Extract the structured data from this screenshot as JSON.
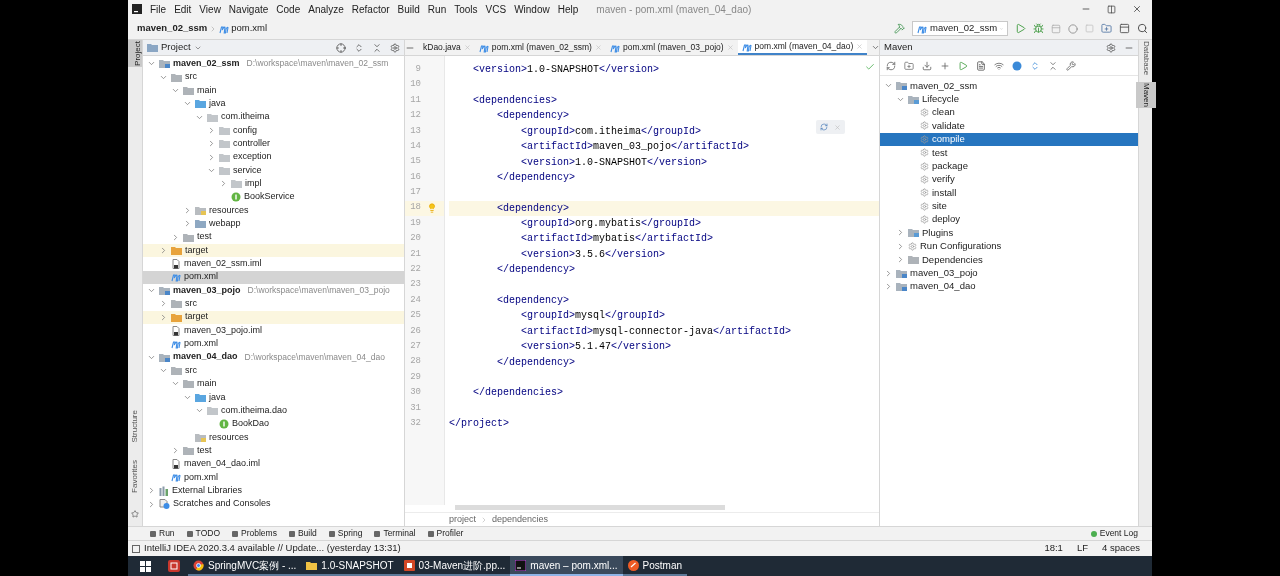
{
  "window": {
    "title": "maven - pom.xml (maven_04_dao)",
    "menu": [
      "File",
      "Edit",
      "View",
      "Navigate",
      "Code",
      "Analyze",
      "Refactor",
      "Build",
      "Run",
      "Tools",
      "VCS",
      "Window",
      "Help"
    ]
  },
  "navbar": {
    "breadcrumb": [
      "maven_02_ssm",
      "pom.xml"
    ],
    "run_config": "maven_02_ssm"
  },
  "left_strip": [
    {
      "label": "Project",
      "selected": true
    },
    {
      "label": "Structure",
      "selected": false
    },
    {
      "label": "Favorites",
      "selected": false
    }
  ],
  "project": {
    "title": "Project",
    "tree": [
      {
        "label": "maven_02_ssm",
        "kind": "module",
        "path": "D:\\workspace\\maven\\maven_02_ssm",
        "expanded": true,
        "selected": false,
        "children": [
          {
            "label": "src",
            "kind": "folder",
            "expanded": true,
            "selected": false,
            "children": [
              {
                "label": "main",
                "kind": "folder",
                "expanded": true,
                "selected": false,
                "children": [
                  {
                    "label": "java",
                    "kind": "source",
                    "expanded": true,
                    "selected": false,
                    "children": [
                      {
                        "label": "com.itheima",
                        "kind": "package",
                        "expanded": true,
                        "selected": false,
                        "children": [
                          {
                            "label": "config",
                            "kind": "package",
                            "expanded": false,
                            "selected": false
                          },
                          {
                            "label": "controller",
                            "kind": "package",
                            "expanded": false,
                            "selected": false
                          },
                          {
                            "label": "exception",
                            "kind": "package",
                            "expanded": false,
                            "selected": false
                          },
                          {
                            "label": "service",
                            "kind": "package",
                            "expanded": true,
                            "selected": false,
                            "children": [
                              {
                                "label": "impl",
                                "kind": "package",
                                "expanded": false,
                                "selected": false
                              },
                              {
                                "label": "BookService",
                                "kind": "interface",
                                "selected": false
                              }
                            ]
                          }
                        ]
                      }
                    ]
                  },
                  {
                    "label": "resources",
                    "kind": "resources",
                    "expanded": false,
                    "selected": false
                  },
                  {
                    "label": "webapp",
                    "kind": "web",
                    "expanded": false,
                    "selected": false
                  }
                ]
              },
              {
                "label": "test",
                "kind": "folder",
                "expanded": false,
                "selected": false
              }
            ]
          },
          {
            "label": "target",
            "kind": "target",
            "expanded": false,
            "selected": false
          },
          {
            "label": "maven_02_ssm.iml",
            "kind": "iml",
            "selected": false
          },
          {
            "label": "pom.xml",
            "kind": "pom",
            "selected": true
          }
        ]
      },
      {
        "label": "maven_03_pojo",
        "kind": "module",
        "path": "D:\\workspace\\maven\\maven_03_pojo",
        "expanded": true,
        "selected": false,
        "children": [
          {
            "label": "src",
            "kind": "folder",
            "expanded": false,
            "selected": false
          },
          {
            "label": "target",
            "kind": "target",
            "expanded": false,
            "selected": false
          },
          {
            "label": "maven_03_pojo.iml",
            "kind": "iml",
            "selected": false
          },
          {
            "label": "pom.xml",
            "kind": "pom",
            "selected": false
          }
        ]
      },
      {
        "label": "maven_04_dao",
        "kind": "module",
        "path": "D:\\workspace\\maven\\maven_04_dao",
        "expanded": true,
        "selected": false,
        "children": [
          {
            "label": "src",
            "kind": "folder",
            "expanded": true,
            "selected": false,
            "children": [
              {
                "label": "main",
                "kind": "folder",
                "expanded": true,
                "selected": false,
                "children": [
                  {
                    "label": "java",
                    "kind": "source",
                    "expanded": true,
                    "selected": false,
                    "children": [
                      {
                        "label": "com.itheima.dao",
                        "kind": "package",
                        "expanded": true,
                        "selected": false,
                        "children": [
                          {
                            "label": "BookDao",
                            "kind": "interface",
                            "selected": false
                          }
                        ]
                      }
                    ]
                  },
                  {
                    "label": "resources",
                    "kind": "resources",
                    "selected": false
                  }
                ]
              },
              {
                "label": "test",
                "kind": "folder",
                "expanded": false,
                "selected": false
              }
            ]
          },
          {
            "label": "maven_04_dao.iml",
            "kind": "iml",
            "selected": false
          },
          {
            "label": "pom.xml",
            "kind": "pom",
            "selected": false
          }
        ]
      },
      {
        "label": "External Libraries",
        "kind": "libs",
        "expanded": false,
        "selected": false
      },
      {
        "label": "Scratches and Consoles",
        "kind": "scratches",
        "expanded": false,
        "selected": false
      }
    ]
  },
  "editor": {
    "tabs": [
      {
        "label": "kDao.java",
        "kind": "java",
        "selected": false
      },
      {
        "label": "pom.xml (maven_02_ssm)",
        "kind": "pom",
        "selected": false
      },
      {
        "label": "pom.xml (maven_03_pojo)",
        "kind": "pom",
        "selected": false
      },
      {
        "label": "pom.xml (maven_04_dao)",
        "kind": "pom",
        "selected": true
      }
    ],
    "lines": [
      {
        "number": "9",
        "text": "    <version>1.0-SNAPSHOT</version>",
        "current": false
      },
      {
        "number": "10",
        "current": false
      },
      {
        "number": "11",
        "text": "    <dependencies>",
        "current": false
      },
      {
        "number": "12",
        "text": "        <dependency>",
        "current": false
      },
      {
        "number": "13",
        "text": "            <groupId>com.itheima</groupId>",
        "current": false
      },
      {
        "number": "14",
        "text": "            <artifactId>maven_03_pojo</artifactId>",
        "current": false
      },
      {
        "number": "15",
        "text": "            <version>1.0-SNAPSHOT</version>",
        "current": false
      },
      {
        "number": "16",
        "text": "        </dependency>",
        "current": false
      },
      {
        "number": "17",
        "current": false
      },
      {
        "number": "18",
        "text": "        <dependency>",
        "current": true
      },
      {
        "number": "19",
        "text": "            <groupId>org.mybatis</groupId>",
        "current": false
      },
      {
        "number": "20",
        "text": "            <artifactId>mybatis</artifactId>",
        "current": false
      },
      {
        "number": "21",
        "text": "            <version>3.5.6</version>",
        "current": false
      },
      {
        "number": "22",
        "text": "        </dependency>",
        "current": false
      },
      {
        "number": "23",
        "current": false
      },
      {
        "number": "24",
        "text": "        <dependency>",
        "current": false
      },
      {
        "number": "25",
        "text": "            <groupId>mysql</groupId>",
        "current": false
      },
      {
        "number": "26",
        "text": "            <artifactId>mysql-connector-java</artifactId>",
        "current": false
      },
      {
        "number": "27",
        "text": "            <version>5.1.47</version>",
        "current": false
      },
      {
        "number": "28",
        "text": "        </dependency>",
        "current": false
      },
      {
        "number": "29",
        "current": false
      },
      {
        "number": "30",
        "text": "    </dependencies>",
        "current": false
      },
      {
        "number": "31",
        "current": false
      },
      {
        "number": "32",
        "text": "</project>",
        "current": false
      }
    ],
    "breadcrumb": [
      "project",
      "dependencies"
    ]
  },
  "maven": {
    "title": "Maven",
    "tree": [
      {
        "label": "maven_02_ssm",
        "kind": "project",
        "expanded": true,
        "selected": false,
        "children": [
          {
            "label": "Lifecycle",
            "kind": "lifecycle",
            "expanded": true,
            "selected": false,
            "children": [
              {
                "label": "clean",
                "kind": "goal",
                "selected": false
              },
              {
                "label": "validate",
                "kind": "goal",
                "selected": false
              },
              {
                "label": "compile",
                "kind": "goal",
                "selected": true
              },
              {
                "label": "test",
                "kind": "goal",
                "selected": false
              },
              {
                "label": "package",
                "kind": "goal",
                "selected": false
              },
              {
                "label": "verify",
                "kind": "goal",
                "selected": false
              },
              {
                "label": "install",
                "kind": "goal",
                "selected": false
              },
              {
                "label": "site",
                "kind": "goal",
                "selected": false
              },
              {
                "label": "deploy",
                "kind": "goal",
                "selected": false
              }
            ]
          },
          {
            "label": "Plugins",
            "kind": "lifecycle",
            "expanded": false,
            "selected": false
          },
          {
            "label": "Run Configurations",
            "kind": "goal",
            "expanded": false,
            "selected": false
          },
          {
            "label": "Dependencies",
            "kind": "folder",
            "expanded": false,
            "selected": false
          }
        ]
      },
      {
        "label": "maven_03_pojo",
        "kind": "project",
        "expanded": false,
        "selected": false
      },
      {
        "label": "maven_04_dao",
        "kind": "project",
        "expanded": false,
        "selected": false
      }
    ]
  },
  "right_strip": [
    {
      "label": "Database",
      "selected": false
    },
    {
      "label": "Maven",
      "selected": true
    }
  ],
  "bottom_tools": [
    "Run",
    "TODO",
    "Problems",
    "Build",
    "Spring",
    "Terminal",
    "Profiler"
  ],
  "event_log": "Event Log",
  "status": {
    "message": "IntelliJ IDEA 2020.3.4 available // Update... (yesterday 13:31)",
    "items": [
      "18:1",
      "LF",
      "4 spaces"
    ]
  },
  "taskbar": [
    {
      "label": "SpringMVC案例 - ...",
      "kind": "browser",
      "selected": false
    },
    {
      "label": "1.0-SNAPSHOT",
      "kind": "folder",
      "selected": false
    },
    {
      "label": "03-Maven进阶.pp...",
      "kind": "slides",
      "selected": false
    },
    {
      "label": "maven – pom.xml...",
      "kind": "ide",
      "selected": true
    },
    {
      "label": "Postman",
      "kind": "postman",
      "selected": false
    }
  ]
}
